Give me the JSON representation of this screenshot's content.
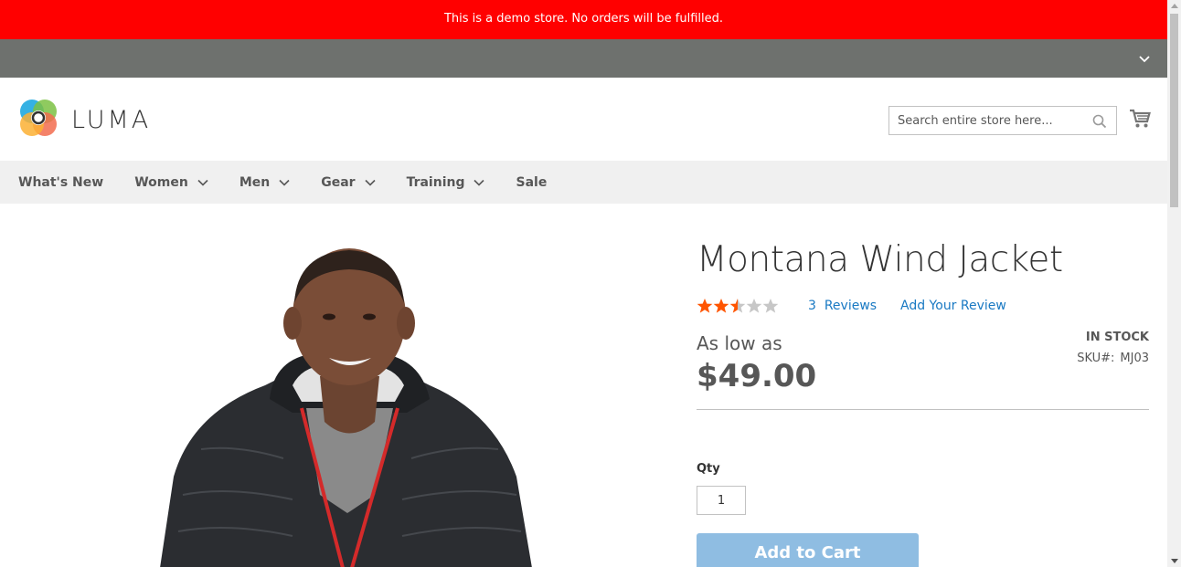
{
  "demo_notice": "This is a demo store. No orders will be fulfilled.",
  "header": {
    "logo_text": "LUMA",
    "search_placeholder": "Search entire store here...",
    "cart_icon": "cart-icon"
  },
  "nav": {
    "items": [
      {
        "label": "What's New",
        "has_dropdown": false
      },
      {
        "label": "Women",
        "has_dropdown": true
      },
      {
        "label": "Men",
        "has_dropdown": true
      },
      {
        "label": "Gear",
        "has_dropdown": true
      },
      {
        "label": "Training",
        "has_dropdown": true
      },
      {
        "label": "Sale",
        "has_dropdown": false
      }
    ]
  },
  "product": {
    "name": "Montana Wind Jacket",
    "rating_stars": 2.5,
    "rating_max": 5,
    "reviews_count": "3",
    "reviews_label": "Reviews",
    "add_review_label": "Add Your Review",
    "price_prefix": "As low as",
    "price": "$49.00",
    "stock_status": "IN STOCK",
    "sku_label": "SKU#:",
    "sku_value": "MJ03",
    "qty_label": "Qty",
    "qty_value": "1",
    "add_to_cart_label": "Add to Cart"
  },
  "colors": {
    "demo_banner": "#ff0000",
    "top_bar": "#6e716e",
    "nav_bg": "#f0f0f0",
    "link": "#1979c3",
    "star_filled": "#ff5501",
    "star_empty": "#c7c7c7",
    "add_to_cart_bg": "#8fbde2"
  }
}
